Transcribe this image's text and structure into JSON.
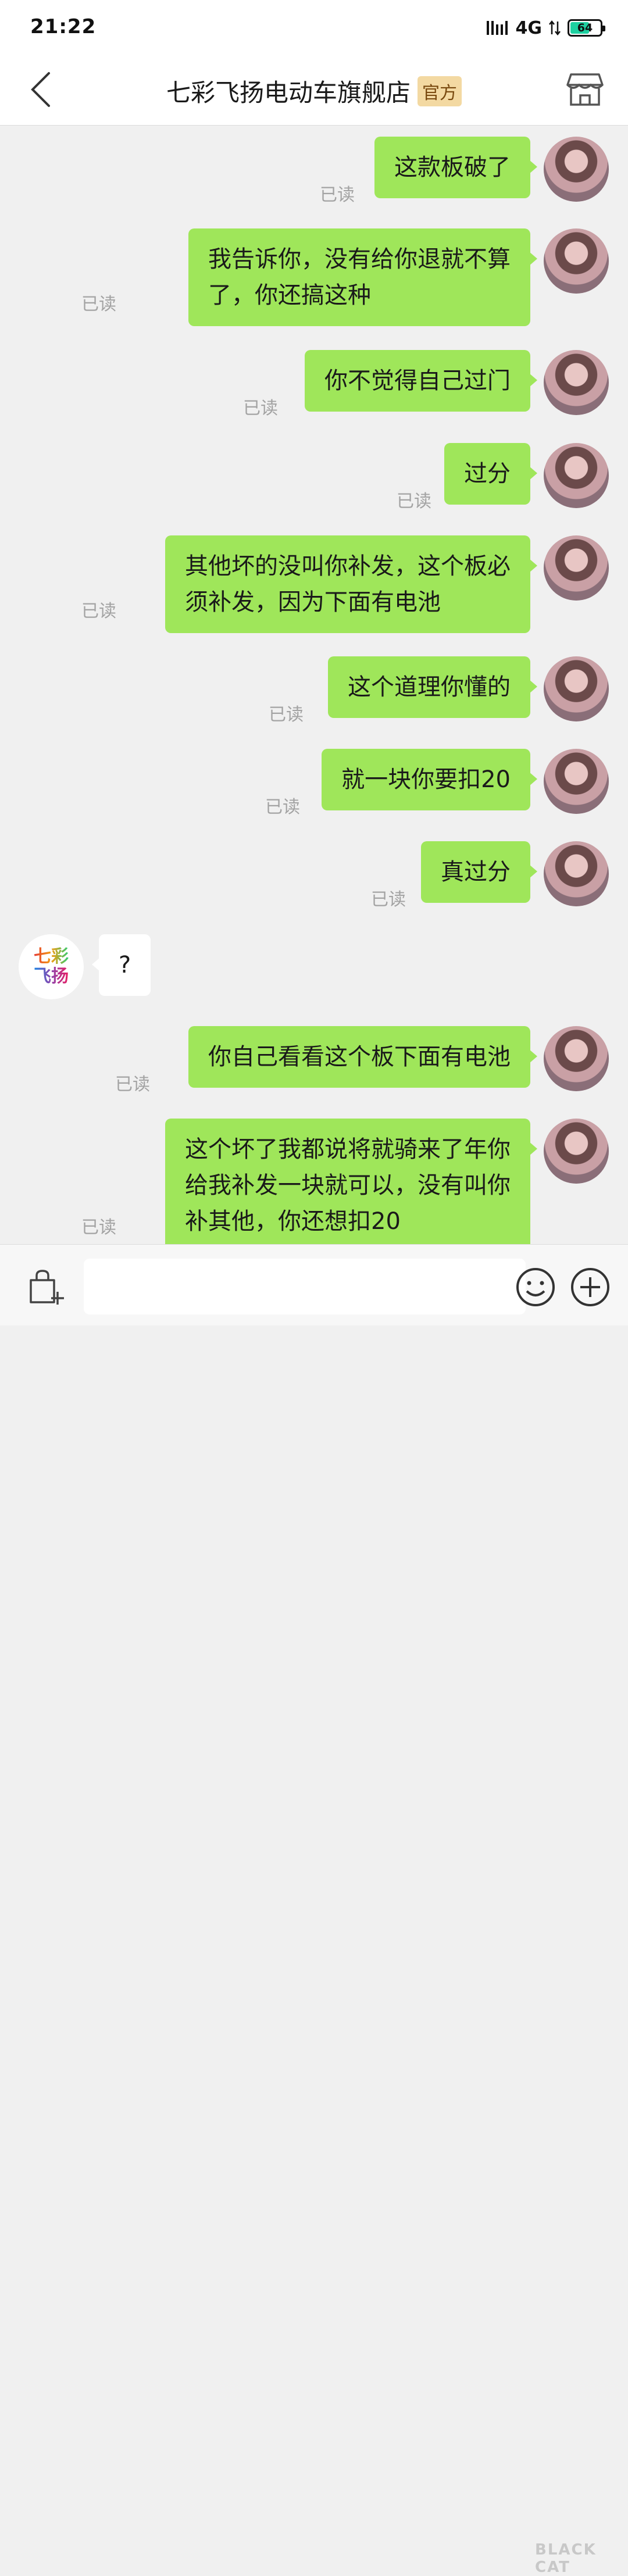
{
  "status_bar": {
    "time": "21:22",
    "network": "4G",
    "battery": "64",
    "battery_level_percent": 64,
    "icons": [
      "signal-icon",
      "data-arrows-icon",
      "battery-icon"
    ]
  },
  "nav": {
    "title": "七彩飞扬电动车旗舰店",
    "badge": "官方",
    "icons": [
      "back-arrow-icon",
      "store-icon"
    ]
  },
  "read_label": "已读",
  "messages": [
    {
      "side": "right",
      "lines": [
        "这款板破了"
      ]
    },
    {
      "side": "right",
      "lines": [
        "我告诉你，没有给你退就不算",
        "了，你还搞这种"
      ]
    },
    {
      "side": "right",
      "lines": [
        "你不觉得自己过门"
      ]
    },
    {
      "side": "right",
      "lines": [
        "过分"
      ]
    },
    {
      "side": "right",
      "lines": [
        "其他坏的没叫你补发，这个板必",
        "须补发，因为下面有电池"
      ]
    },
    {
      "side": "right",
      "lines": [
        "这个道理你懂的"
      ]
    },
    {
      "side": "right",
      "lines": [
        "就一块你要扣20"
      ]
    },
    {
      "side": "right",
      "lines": [
        "真过分"
      ]
    },
    {
      "side": "left",
      "lines": [
        "?"
      ]
    },
    {
      "side": "right",
      "lines": [
        "你自己看看这个板下面有电池"
      ]
    },
    {
      "side": "right",
      "lines": [
        "这个坏了我都说将就骑来了年你",
        "给我补发一块就可以，没有叫你",
        "补其他，你还想扣20"
      ]
    }
  ],
  "store_avatar": {
    "line1": "七彩",
    "line2": "飞扬"
  },
  "input_bar": {
    "placeholder": "",
    "icons": [
      "bag-add-icon",
      "emoji-icon",
      "plus-icon"
    ]
  },
  "watermark": "BLACK CAT",
  "colors": {
    "outgoing_bubble": "#9fe65a",
    "incoming_bubble": "#ffffff",
    "chat_background": "#f0f0f0",
    "badge_background": "#f3d9a2",
    "read_text": "#a3a3a3"
  }
}
